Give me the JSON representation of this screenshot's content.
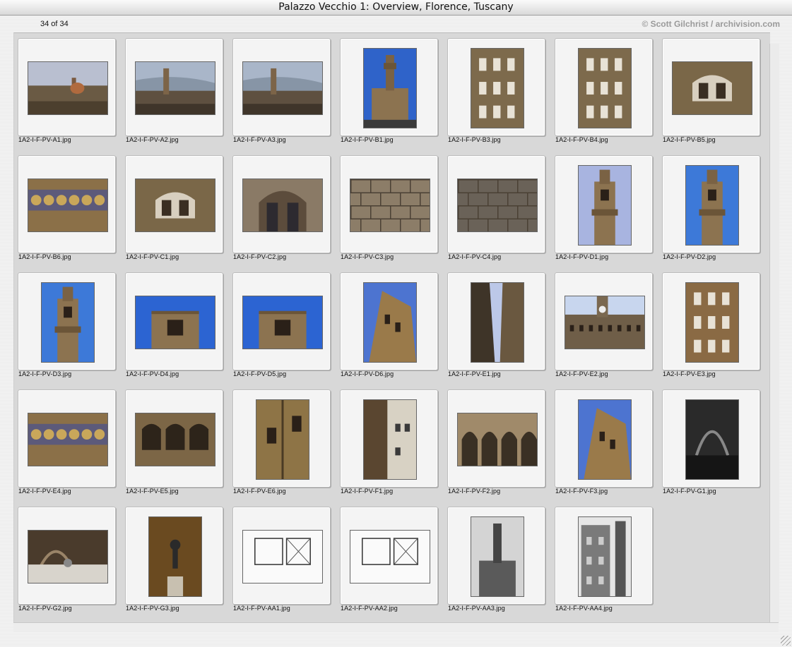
{
  "window": {
    "title": "Palazzo Vecchio 1: Overview, Florence, Tuscany",
    "count": "34 of 34",
    "credit": "© Scott Gilchrist / archivision.com"
  },
  "slides": [
    {
      "file": "1A2-I-F-PV-A1.jpg",
      "orient": "landscape",
      "scene": "panorama"
    },
    {
      "file": "1A2-I-F-PV-A2.jpg",
      "orient": "landscape",
      "scene": "panorama-tower"
    },
    {
      "file": "1A2-I-F-PV-A3.jpg",
      "orient": "landscape",
      "scene": "panorama-tower"
    },
    {
      "file": "1A2-I-F-PV-B1.jpg",
      "orient": "portrait",
      "scene": "palace-blue"
    },
    {
      "file": "1A2-I-F-PV-B3.jpg",
      "orient": "portrait",
      "scene": "facade"
    },
    {
      "file": "1A2-I-F-PV-B4.jpg",
      "orient": "portrait",
      "scene": "facade-windows"
    },
    {
      "file": "1A2-I-F-PV-B5.jpg",
      "orient": "landscape",
      "scene": "window-detail"
    },
    {
      "file": "1A2-I-F-PV-B6.jpg",
      "orient": "landscape",
      "scene": "frieze"
    },
    {
      "file": "1A2-I-F-PV-C1.jpg",
      "orient": "landscape",
      "scene": "window-detail"
    },
    {
      "file": "1A2-I-F-PV-C2.jpg",
      "orient": "landscape",
      "scene": "arch-detail"
    },
    {
      "file": "1A2-I-F-PV-C3.jpg",
      "orient": "landscape",
      "scene": "stone"
    },
    {
      "file": "1A2-I-F-PV-C4.jpg",
      "orient": "landscape",
      "scene": "stone-dark"
    },
    {
      "file": "1A2-I-F-PV-D1.jpg",
      "orient": "portrait",
      "scene": "tower-pale"
    },
    {
      "file": "1A2-I-F-PV-D2.jpg",
      "orient": "portrait",
      "scene": "tower-blue"
    },
    {
      "file": "1A2-I-F-PV-D3.jpg",
      "orient": "portrait",
      "scene": "tower-blue"
    },
    {
      "file": "1A2-I-F-PV-D4.jpg",
      "orient": "landscape",
      "scene": "tower-top-blue"
    },
    {
      "file": "1A2-I-F-PV-D5.jpg",
      "orient": "landscape",
      "scene": "tower-top-blue"
    },
    {
      "file": "1A2-I-F-PV-D6.jpg",
      "orient": "portrait",
      "scene": "tower-angle"
    },
    {
      "file": "1A2-I-F-PV-E1.jpg",
      "orient": "portrait",
      "scene": "street"
    },
    {
      "file": "1A2-I-F-PV-E2.jpg",
      "orient": "landscape",
      "scene": "battlement"
    },
    {
      "file": "1A2-I-F-PV-E3.jpg",
      "orient": "portrait",
      "scene": "facade-warm"
    },
    {
      "file": "1A2-I-F-PV-E4.jpg",
      "orient": "landscape",
      "scene": "frieze"
    },
    {
      "file": "1A2-I-F-PV-E5.jpg",
      "orient": "landscape",
      "scene": "gallery"
    },
    {
      "file": "1A2-I-F-PV-E6.jpg",
      "orient": "portrait",
      "scene": "corner"
    },
    {
      "file": "1A2-I-F-PV-F1.jpg",
      "orient": "portrait",
      "scene": "courtyard-street"
    },
    {
      "file": "1A2-I-F-PV-F2.jpg",
      "orient": "landscape",
      "scene": "corbels"
    },
    {
      "file": "1A2-I-F-PV-F3.jpg",
      "orient": "portrait",
      "scene": "tower-angle"
    },
    {
      "file": "1A2-I-F-PV-G1.jpg",
      "orient": "portrait",
      "scene": "interior-dark"
    },
    {
      "file": "1A2-I-F-PV-G2.jpg",
      "orient": "landscape",
      "scene": "courtyard"
    },
    {
      "file": "1A2-I-F-PV-G3.jpg",
      "orient": "portrait",
      "scene": "statue"
    },
    {
      "file": "1A2-I-F-PV-AA1.jpg",
      "orient": "landscape",
      "scene": "plan"
    },
    {
      "file": "1A2-I-F-PV-AA2.jpg",
      "orient": "landscape",
      "scene": "plan"
    },
    {
      "file": "1A2-I-F-PV-AA3.jpg",
      "orient": "portrait",
      "scene": "bw-tower"
    },
    {
      "file": "1A2-I-F-PV-AA4.jpg",
      "orient": "portrait",
      "scene": "bw-facade"
    }
  ],
  "colors": {
    "sky": "#2f63c9",
    "stone": "#8c7350",
    "pane": "#d8d8d8"
  }
}
